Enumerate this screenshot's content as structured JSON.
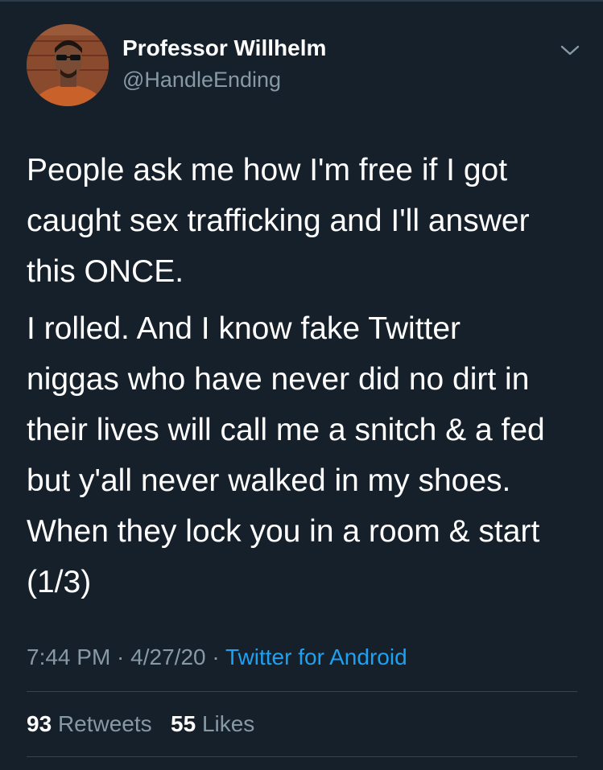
{
  "colors": {
    "background": "#15202b",
    "primary_text": "#ffffff",
    "secondary_text": "#8899a6",
    "link": "#1da1f2",
    "divider": "#38444d"
  },
  "author": {
    "display_name": "Professor Willhelm",
    "handle": "@HandleEnding",
    "avatar_icon": "profile-photo-avatar"
  },
  "tweet": {
    "paragraphs": [
      [
        "People ask me how I'm free if I got",
        "caught sex trafficking and I'll answer",
        "this ONCE."
      ],
      [
        "I rolled. And I know fake Twitter",
        "niggas who have never did no dirt in",
        "their lives will call me a snitch & a fed",
        "but y'all never walked in my shoes.",
        "When they lock you in a room & start",
        "(1/3)"
      ]
    ]
  },
  "meta": {
    "time": "7:44 PM",
    "separator": " · ",
    "date": "4/27/20",
    "source": "Twitter for Android"
  },
  "stats": {
    "retweets_count": "93",
    "retweets_label": "Retweets",
    "likes_count": "55",
    "likes_label": "Likes"
  },
  "menu_icon": "chevron-down-icon"
}
